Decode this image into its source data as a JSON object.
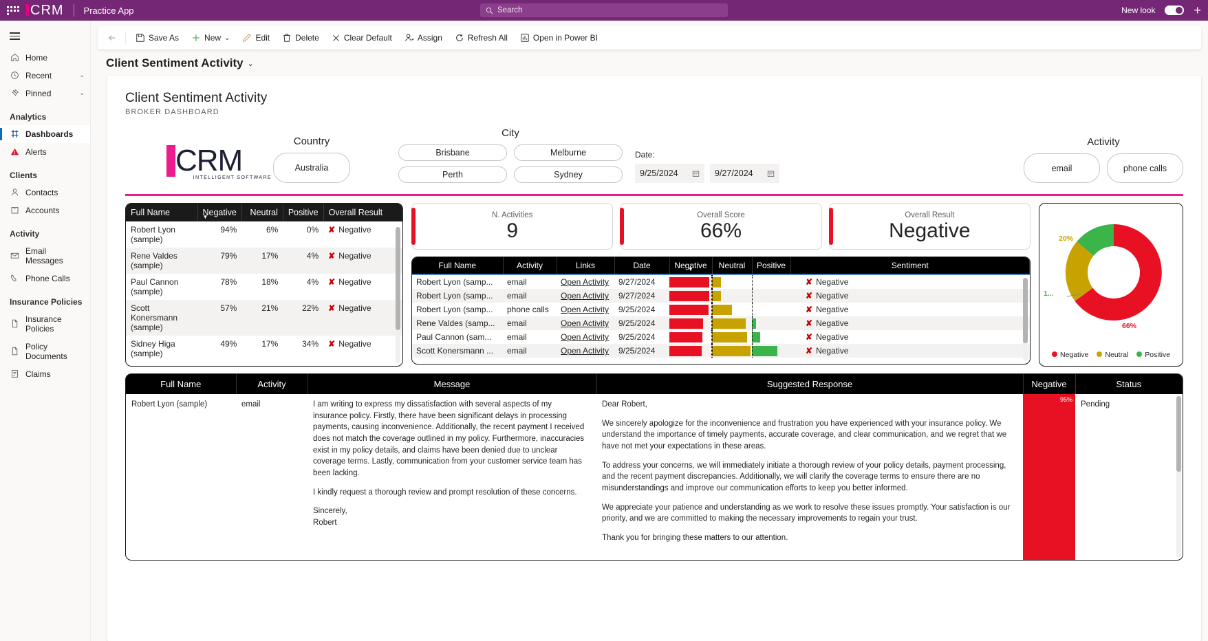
{
  "appbar": {
    "brand_text": "CRM",
    "brand_sub": "INTELLIGENT SOFTWARE",
    "app_name": "Practice App",
    "search_placeholder": "Search",
    "new_look_label": "New look"
  },
  "sidebar": {
    "top_items": [
      {
        "label": "Home",
        "icon": "home-icon",
        "chevron": ""
      },
      {
        "label": "Recent",
        "icon": "clock-icon",
        "chevron": "⌄"
      },
      {
        "label": "Pinned",
        "icon": "pin-icon",
        "chevron": "⌄"
      }
    ],
    "groups": [
      {
        "title": "Analytics",
        "items": [
          {
            "label": "Dashboards",
            "icon": "dashboard-icon",
            "active": true
          },
          {
            "label": "Alerts",
            "icon": "alert-icon",
            "active": false
          }
        ]
      },
      {
        "title": "Clients",
        "items": [
          {
            "label": "Contacts",
            "icon": "person-icon",
            "active": false
          },
          {
            "label": "Accounts",
            "icon": "building-icon",
            "active": false
          }
        ]
      },
      {
        "title": "Activity",
        "items": [
          {
            "label": "Email Messages",
            "icon": "mail-icon",
            "active": false
          },
          {
            "label": "Phone Calls",
            "icon": "phone-icon",
            "active": false
          }
        ]
      },
      {
        "title": "Insurance Policies",
        "items": [
          {
            "label": "Insurance Policies",
            "icon": "document-icon",
            "active": false
          },
          {
            "label": "Policy Documents",
            "icon": "document-icon",
            "active": false
          },
          {
            "label": "Claims",
            "icon": "claim-icon",
            "active": false
          }
        ]
      }
    ]
  },
  "commandbar": {
    "back_icon": "back-arrow-icon",
    "items": [
      {
        "label": "Save As",
        "icon": "save-as-icon"
      },
      {
        "label": "New",
        "icon": "plus-icon",
        "chevron": "⌄"
      },
      {
        "label": "Edit",
        "icon": "pencil-icon"
      },
      {
        "label": "Delete",
        "icon": "trash-icon"
      },
      {
        "label": "Clear Default",
        "icon": "x-icon"
      },
      {
        "label": "Assign",
        "icon": "assign-person-icon"
      },
      {
        "label": "Refresh All",
        "icon": "refresh-icon"
      },
      {
        "label": "Open in Power BI",
        "icon": "powerbi-icon"
      }
    ]
  },
  "page": {
    "title": "Client Sentiment Activity",
    "title_chevron": "⌄"
  },
  "report": {
    "title": "Client Sentiment Activity",
    "subtitle": "BROKER DASHBOARD",
    "logo_text": "CRM",
    "logo_sub": "INTELLIGENT SOFTWARE",
    "filters": {
      "country": {
        "label": "Country",
        "options": [
          "Australia"
        ]
      },
      "city": {
        "label": "City",
        "options": [
          "Brisbane",
          "Melburne",
          "Perth",
          "Sydney"
        ]
      },
      "date": {
        "label": "Date:",
        "from": "9/25/2024",
        "to": "9/27/2024",
        "calendar_icon": "calendar-icon"
      },
      "activity": {
        "label": "Activity",
        "options": [
          "email",
          "phone calls"
        ]
      }
    },
    "summary_table": {
      "columns": [
        "Full Name",
        "Negative",
        "Neutral",
        "Positive",
        "Overall Result"
      ],
      "sorted_column": "Negative",
      "rows": [
        {
          "name": "Robert Lyon (sample)",
          "negative": "94%",
          "neutral": "6%",
          "positive": "0%",
          "overall": "Negative"
        },
        {
          "name": "Rene Valdes (sample)",
          "negative": "79%",
          "neutral": "17%",
          "positive": "4%",
          "overall": "Negative"
        },
        {
          "name": "Paul Cannon (sample)",
          "negative": "78%",
          "neutral": "18%",
          "positive": "4%",
          "overall": "Negative"
        },
        {
          "name": "Scott Konersmann (sample)",
          "negative": "57%",
          "neutral": "21%",
          "positive": "22%",
          "overall": "Negative"
        },
        {
          "name": "Sidney Higa (sample)",
          "negative": "49%",
          "neutral": "17%",
          "positive": "34%",
          "overall": "Negative"
        }
      ]
    },
    "kpis": [
      {
        "label": "N. Activities",
        "value": "9"
      },
      {
        "label": "Overall Score",
        "value": "66%"
      },
      {
        "label": "Overall Result",
        "value": "Negative"
      }
    ],
    "detail_table": {
      "columns": [
        "Full Name",
        "Activity",
        "Links",
        "Date",
        "Negative",
        "Neutral",
        "Positive",
        "Sentiment"
      ],
      "sorted_column": "Negative",
      "link_label": "Open Activity",
      "rows": [
        {
          "name": "Robert Lyon (samp...",
          "activity": "email",
          "link": "Open Activity",
          "date": "9/27/2024",
          "negative": 94,
          "neutral": 6,
          "positive": 0,
          "sentiment": "Negative"
        },
        {
          "name": "Robert Lyon (samp...",
          "activity": "email",
          "link": "Open Activity",
          "date": "9/27/2024",
          "negative": 94,
          "neutral": 6,
          "positive": 0,
          "sentiment": "Negative"
        },
        {
          "name": "Robert Lyon (samp...",
          "activity": "phone calls",
          "link": "Open Activity",
          "date": "9/25/2024",
          "negative": 92,
          "neutral": 18,
          "positive": 0,
          "sentiment": "Negative"
        },
        {
          "name": "Rene Valdes (samp...",
          "activity": "email",
          "link": "Open Activity",
          "date": "9/25/2024",
          "negative": 79,
          "neutral": 40,
          "positive": 4,
          "sentiment": "Negative"
        },
        {
          "name": "Paul Cannon (sam...",
          "activity": "email",
          "link": "Open Activity",
          "date": "9/25/2024",
          "negative": 78,
          "neutral": 42,
          "positive": 9,
          "sentiment": "Negative"
        },
        {
          "name": "Scott Konersmann ...",
          "activity": "email",
          "link": "Open Activity",
          "date": "9/25/2024",
          "negative": 76,
          "neutral": 48,
          "positive": 30,
          "sentiment": "Negative"
        }
      ]
    },
    "message_table": {
      "columns": [
        "Full Name",
        "Activity",
        "Message",
        "Suggested Response",
        "Negative",
        "Status"
      ],
      "rows": [
        {
          "name": "Robert Lyon (sample)",
          "activity": "email",
          "message": [
            "I am writing to express my dissatisfaction with several aspects of my insurance policy. Firstly, there have been significant delays in processing payments, causing inconvenience. Additionally, the recent payment I received does not match the coverage outlined in my policy. Furthermore, inaccuracies exist in my policy details, and claims have been denied due to unclear coverage terms. Lastly, communication from your customer service team has been lacking.",
            "I kindly request a thorough review and prompt resolution of these concerns.",
            "Sincerely,",
            "Robert"
          ],
          "response": [
            "Dear Robert,",
            "We sincerely apologize for the inconvenience and frustration you have experienced with your insurance policy. We understand the importance of timely payments, accurate coverage, and clear communication, and we regret that we have not met your expectations in these areas.",
            "To address your concerns, we will immediately initiate a thorough review of your policy details, payment processing, and the recent payment discrepancies. Additionally, we will clarify the coverage terms to ensure there are no misunderstandings and improve our communication efforts to keep you better informed.",
            "We appreciate your patience and understanding as we work to resolve these issues promptly. Your satisfaction is our priority, and we are committed to making the necessary improvements to regain your trust.",
            "Thank you for bringing these matters to our attention."
          ],
          "negative_pct": "95%",
          "status": "Pending"
        }
      ]
    }
  },
  "chart_data": {
    "type": "pie",
    "title": "",
    "categories": [
      "Negative",
      "Neutral",
      "Positive"
    ],
    "values": [
      66,
      20,
      14
    ],
    "labels": [
      "66%",
      "20%",
      "1..."
    ],
    "colors": [
      "#e81123",
      "#c8a200",
      "#3bb44a"
    ],
    "legend": [
      "Negative",
      "Neutral",
      "Positive"
    ],
    "legend_position": "bottom",
    "donut": true
  }
}
